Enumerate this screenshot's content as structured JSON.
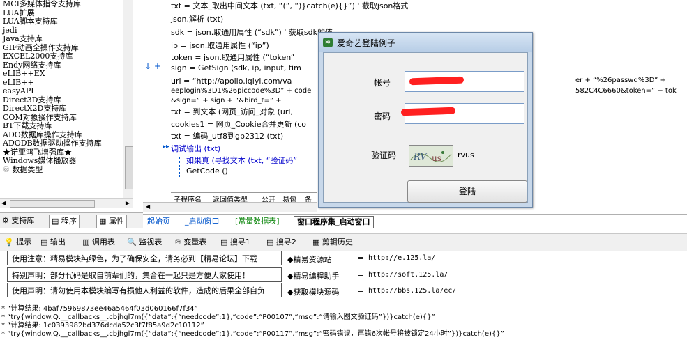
{
  "library": {
    "items": [
      "MCI多媒体指令支持库",
      "LUA扩展",
      "LUA脚本支持库",
      "jedi",
      "Java支持库",
      "GIF动画全操作支持库",
      "EXCEL2000支持库",
      "Endy网络支持库",
      "eLIB++EX",
      "eLIB++",
      "easyAPI",
      "Direct3D支持库",
      "DirectX2D支持库",
      "COM对象操作支持库",
      "BT下载支持库",
      "ADO数据库操作支持库",
      "ADODB数据驱动操作支持库",
      "★诺亚鸿飞增强库★",
      "Windows媒体播放器",
      "数据类型"
    ],
    "tabs": [
      "支持库",
      "程序",
      "属性"
    ]
  },
  "code": {
    "lines": [
      "txt = 文本_取出中间文本 (txt, “(”, “)}catch(e){}”)  ' 截取json格式",
      "json.解析 (txt)",
      "sdk = json.取通用属性 (“sdk”)  ' 获取sdk的值",
      "ip = json.取通用属性 (“ip”)",
      "token = json.取通用属性 (“token”",
      "sign = GetSign (sdk, ip, input, tim",
      "url = “http://apollo.iqiyi.com/va",
      "eeplogin%3D1%26piccode%3D” + code",
      "&sign=” + sign + “&bird_t=” +",
      "txt = 到文本 (网页_访问_对象 (url, ",
      "cookies1 = 网页_Cookie合并更新 (co",
      "txt = 编码_utf8到gb2312 (txt)",
      "调试输出 (txt)",
      "如果真 (寻找文本 (txt, “验证码”",
      "GetCode ()"
    ],
    "right_fragments": [
      "er + “%26passwd%3D” +",
      "582C4C6660&token=” + tok"
    ],
    "table_headers": [
      "子程序名",
      "返回值类型",
      "公开",
      "易包",
      "备"
    ]
  },
  "doc_tabs": [
    "起始页",
    "_启动窗口",
    "[常量数据表]",
    "窗口程序集_启动窗口"
  ],
  "output_toolbar": [
    "提示",
    "输出",
    "调用表",
    "监视表",
    "变量表",
    "搜寻1",
    "搜寻2",
    "剪辑历史"
  ],
  "notices": [
    "使用注意：精易模块纯绿色，为了确保安全，请务必到【精易论坛】下载",
    "特别声明：部分代码是取自前辈们的，集合在一起只是方便大家使用！",
    "使用声明：请勿使用本模块编写有损他人利益的软件，造成的后果全部自负"
  ],
  "sites": [
    {
      "label": "◆精易资源站",
      "eq": "=",
      "url": "http://e.125.la/"
    },
    {
      "label": "◆精易编程助手",
      "eq": "=",
      "url": "http://soft.125.la/"
    },
    {
      "label": "◆获取模块源码",
      "eq": "=",
      "url": "http://bbs.125.la/ec/"
    }
  ],
  "log": [
    "* “计算结果: 4baf75969873ee46a5464f03d060166f7f34”",
    "* “try{window.Q.__callbacks__.cbjhgl7m({“data”:{“needcode”:1},“code”:“P00107”,“msg”:“请输入图文验证码”})}catch(e){}”",
    "* “计算结果: 1c0393982bd376dcda52c3f7f85a9d2c10112”",
    "* “try{window.Q.__callbacks__.cbjhgl7m({“data”:{“needcode”:1},“code”:“P00117”,“msg”:“密码错误，再错6次帐号将被锁定24小时”})}catch(e){}”"
  ],
  "dialog": {
    "title": "爱奇艺登陆例子",
    "account_label": "帐号",
    "password_label": "密码",
    "captcha_label": "验证码",
    "captcha_value": "rvus",
    "login_label": "登陆"
  }
}
